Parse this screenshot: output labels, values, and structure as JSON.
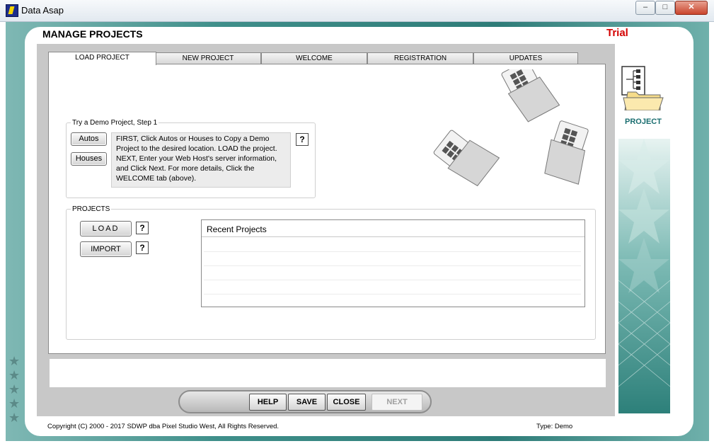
{
  "window": {
    "title": "Data Asap",
    "controls": [
      "–",
      "□",
      "✕"
    ]
  },
  "header": {
    "title": "MANAGE PROJECTS",
    "badge": "Trial"
  },
  "tabs": [
    {
      "label": "LOAD PROJECT",
      "active": true
    },
    {
      "label": "NEW PROJECT",
      "active": false
    },
    {
      "label": "WELCOME",
      "active": false
    },
    {
      "label": "REGISTRATION",
      "active": false
    },
    {
      "label": "UPDATES",
      "active": false
    }
  ],
  "demo": {
    "legend": "Try a Demo Project, Step 1",
    "autos_label": "Autos",
    "houses_label": "Houses",
    "help_label": "?",
    "instructions": "FIRST, Click Autos or Houses to Copy a Demo Project to the desired location.  LOAD the project.  NEXT, Enter your Web Host's server information, and Click Next.  For more details, Click the WELCOME tab (above)."
  },
  "projects": {
    "legend": "PROJECTS",
    "load_label": "LOAD",
    "import_label": "IMPORT",
    "help_label": "?",
    "recent_header": "Recent Projects",
    "recent_items": [
      "",
      "",
      "",
      "",
      ""
    ]
  },
  "sidebar": {
    "label": "PROJECT"
  },
  "nav": {
    "help": "HELP",
    "save": "SAVE",
    "close": "CLOSE",
    "next": "NEXT"
  },
  "footer": {
    "copyright": "Copyright (C) 2000 - 2017 SDWP dba Pixel Studio West, All Rights Reserved.",
    "type": "Type: Demo"
  },
  "colors": {
    "trial": "#d40000",
    "teal": "#2e7c78",
    "sidebar_label": "#1a6e70"
  }
}
